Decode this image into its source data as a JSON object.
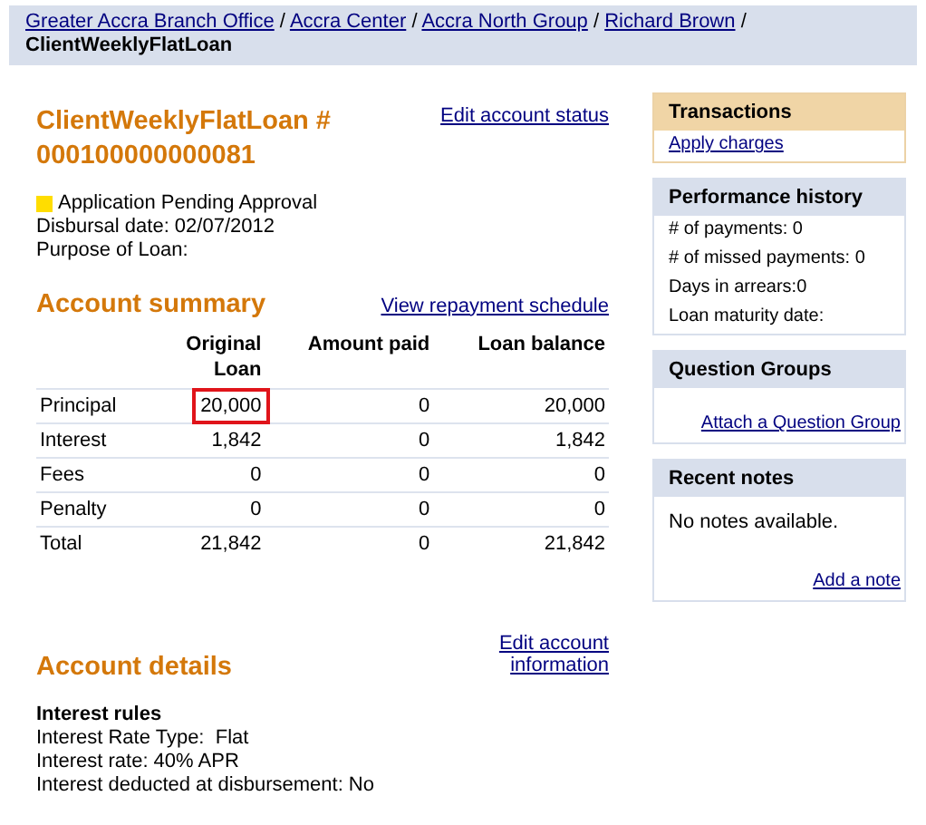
{
  "breadcrumb": {
    "links": [
      "Greater Accra Branch Office",
      "Accra Center",
      "Accra North Group",
      "Richard Brown"
    ],
    "separator": "/",
    "current": "ClientWeeklyFlatLoan"
  },
  "account": {
    "title": "ClientWeeklyFlatLoan # 000100000000081",
    "edit_link": "Edit account status",
    "status": {
      "label": "Application Pending Approval",
      "color": "#ffdd00"
    },
    "details": [
      "Disbursal date: 02/07/2012",
      "Purpose of Loan:"
    ]
  },
  "summary": {
    "title": "Account summary",
    "link": "View repayment schedule",
    "columns": [
      "Original Loan",
      "Amount paid",
      "Loan balance"
    ],
    "rows": [
      {
        "label": "Principal",
        "cells": [
          {
            "text": "20,000",
            "highlighted": true
          },
          {
            "text": "0",
            "highlighted": false
          },
          {
            "text": "20,000",
            "highlighted": false
          }
        ]
      },
      {
        "label": "Interest",
        "cells": [
          {
            "text": "1,842",
            "highlighted": false
          },
          {
            "text": "0",
            "highlighted": false
          },
          {
            "text": "1,842",
            "highlighted": false
          }
        ]
      },
      {
        "label": "Fees",
        "cells": [
          {
            "text": "0",
            "highlighted": false
          },
          {
            "text": "0",
            "highlighted": false
          },
          {
            "text": "0",
            "highlighted": false
          }
        ]
      },
      {
        "label": "Penalty",
        "cells": [
          {
            "text": "0",
            "highlighted": false
          },
          {
            "text": "0",
            "highlighted": false
          },
          {
            "text": "0",
            "highlighted": false
          }
        ]
      },
      {
        "label": "Total",
        "cells": [
          {
            "text": "21,842",
            "highlighted": false
          },
          {
            "text": "0",
            "highlighted": false
          },
          {
            "text": "21,842",
            "highlighted": false
          }
        ]
      }
    ]
  },
  "details": {
    "title": "Account details",
    "link": "Edit account information",
    "subtitle": "Interest rules",
    "lines": [
      "Interest Rate Type:  Flat",
      "Interest rate: 40% APR",
      "Interest deducted at disbursement: No"
    ]
  },
  "sidebar": [
    {
      "title": "Transactions",
      "kind": "links",
      "highlighted": true,
      "links": [
        "Apply charges"
      ]
    },
    {
      "title": "Performance history",
      "kind": "lines",
      "highlighted": false,
      "lines": [
        "# of payments: 0",
        "# of missed payments: 0",
        "Days in arrears:0",
        "Loan maturity date:"
      ]
    },
    {
      "title": "Question Groups",
      "kind": "action",
      "highlighted": false,
      "links": [
        "Attach a Question Group"
      ]
    },
    {
      "title": "Recent notes",
      "kind": "notes",
      "highlighted": false,
      "lines": [
        "No notes available."
      ],
      "links": [
        "Add a note"
      ]
    }
  ]
}
